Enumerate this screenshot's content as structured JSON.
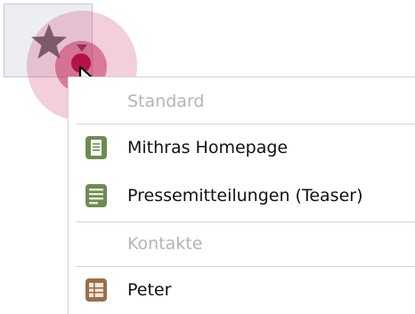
{
  "toolbar": {
    "star_button": {
      "icon": "star-icon",
      "dropdown_icon": "chevron-down-icon"
    }
  },
  "menu": {
    "sections": [
      {
        "header": "Standard",
        "items": [
          {
            "label": "Mithras Homepage",
            "icon": "page-icon"
          },
          {
            "label": "Pressemitteilungen (Teaser)",
            "icon": "list-page-icon"
          }
        ]
      },
      {
        "header": "Kontakte",
        "items": [
          {
            "label": "Peter",
            "icon": "contact-card-icon"
          }
        ]
      }
    ]
  },
  "colors": {
    "icon_green": "#6f8a52",
    "icon_brown": "#9a6e4c",
    "click_highlight": "#b5124a",
    "header_gray": "#b4b4b4"
  }
}
